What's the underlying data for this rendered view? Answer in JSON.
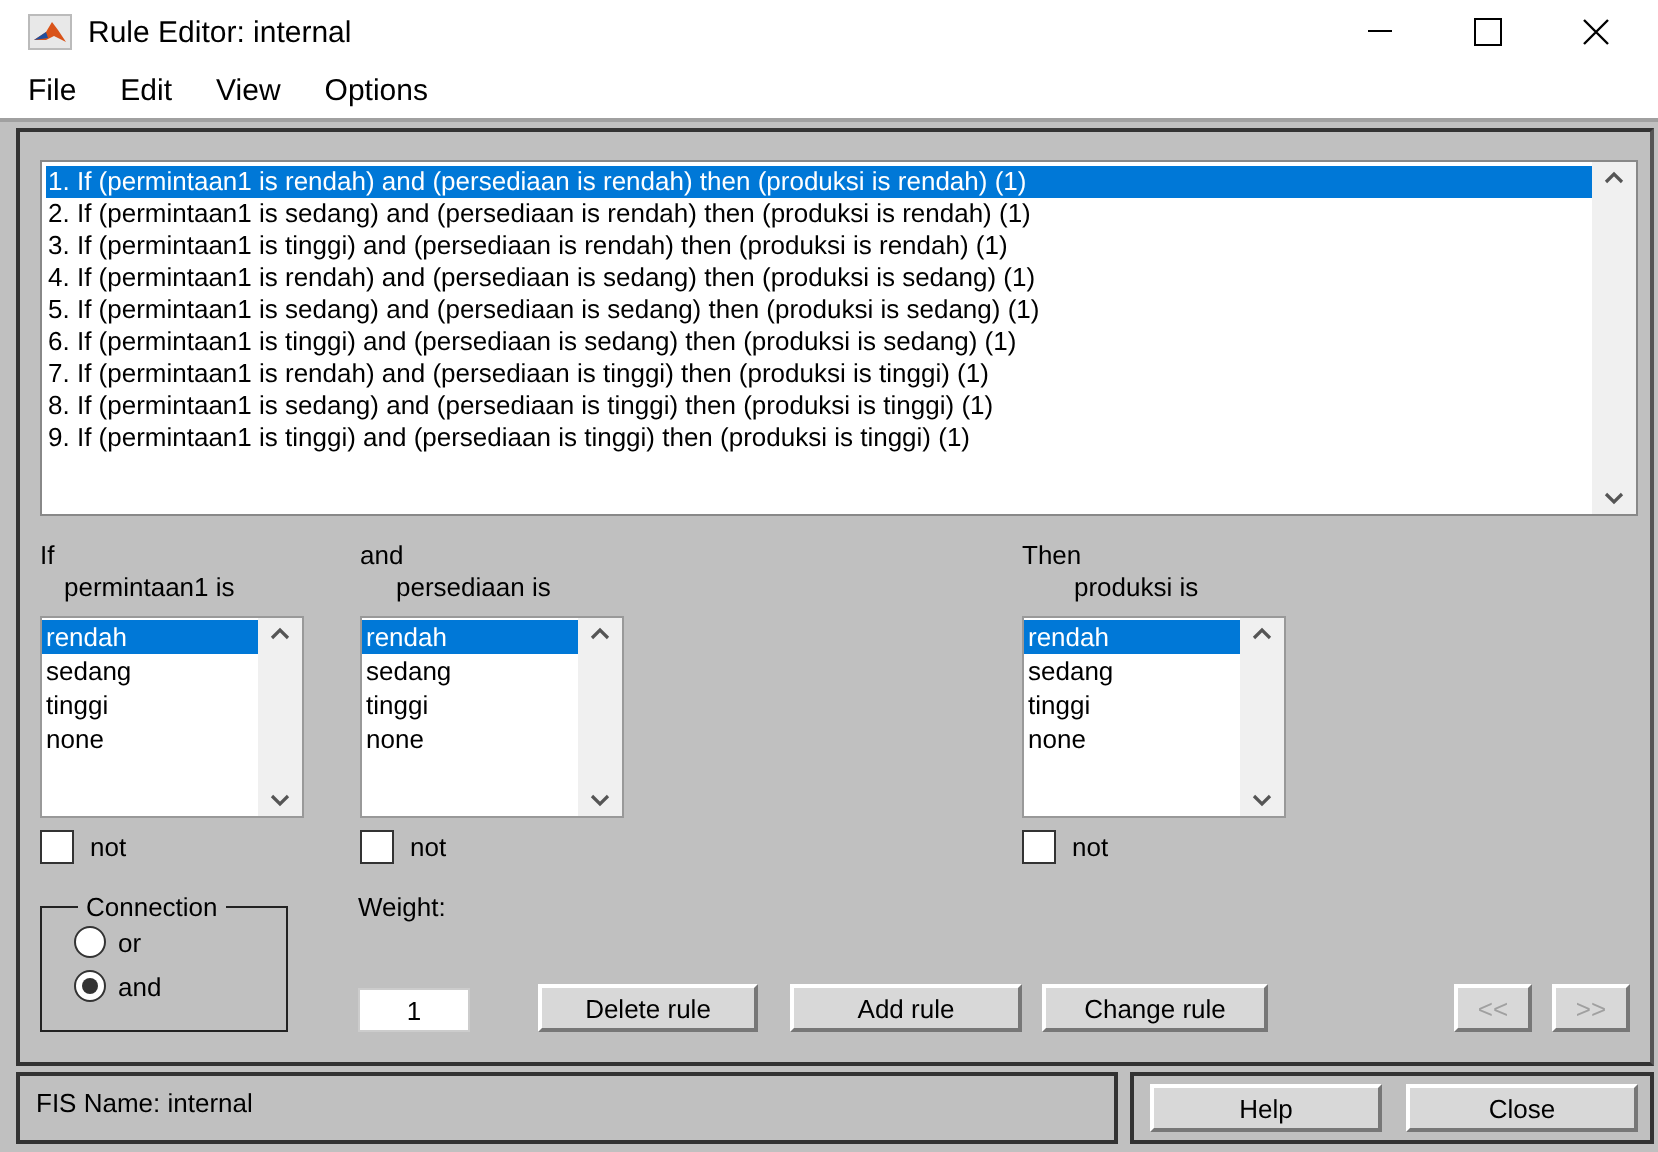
{
  "window": {
    "title": "Rule Editor: internal"
  },
  "menu": [
    "File",
    "Edit",
    "View",
    "Options"
  ],
  "rules": [
    {
      "text": "1. If (permintaan1 is rendah) and (persediaan is rendah) then (produksi is rendah) (1)",
      "selected": true
    },
    {
      "text": "2. If (permintaan1 is sedang) and (persediaan is rendah) then (produksi is rendah) (1)",
      "selected": false
    },
    {
      "text": "3. If (permintaan1 is tinggi) and (persediaan is rendah) then (produksi is rendah) (1)",
      "selected": false
    },
    {
      "text": "4. If (permintaan1 is rendah) and (persediaan is sedang) then (produksi is sedang) (1)",
      "selected": false
    },
    {
      "text": "5. If (permintaan1 is sedang) and (persediaan is sedang) then (produksi is sedang) (1)",
      "selected": false
    },
    {
      "text": "6. If (permintaan1 is tinggi) and (persediaan is sedang) then (produksi is sedang) (1)",
      "selected": false
    },
    {
      "text": "7. If (permintaan1 is rendah) and (persediaan is tinggi) then (produksi is tinggi) (1)",
      "selected": false
    },
    {
      "text": "8. If (permintaan1 is sedang) and (persediaan is tinggi) then (produksi is tinggi) (1)",
      "selected": false
    },
    {
      "text": "9. If (permintaan1 is tinggi) and (persediaan is tinggi) then (produksi is tinggi) (1)",
      "selected": false
    }
  ],
  "variables": [
    {
      "heading": "If",
      "label": "permintaan1 is",
      "options": [
        {
          "text": "rendah",
          "selected": true
        },
        {
          "text": "sedang",
          "selected": false
        },
        {
          "text": "tinggi",
          "selected": false
        },
        {
          "text": "none",
          "selected": false
        }
      ],
      "not": {
        "label": "not",
        "checked": false
      }
    },
    {
      "heading": "and",
      "label": "persediaan is",
      "options": [
        {
          "text": "rendah",
          "selected": true
        },
        {
          "text": "sedang",
          "selected": false
        },
        {
          "text": "tinggi",
          "selected": false
        },
        {
          "text": "none",
          "selected": false
        }
      ],
      "not": {
        "label": "not",
        "checked": false
      }
    },
    {
      "heading": "Then",
      "label": "produksi is",
      "options": [
        {
          "text": "rendah",
          "selected": true
        },
        {
          "text": "sedang",
          "selected": false
        },
        {
          "text": "tinggi",
          "selected": false
        },
        {
          "text": "none",
          "selected": false
        }
      ],
      "not": {
        "label": "not",
        "checked": false
      }
    }
  ],
  "connection": {
    "title": "Connection",
    "options": [
      {
        "label": "or",
        "selected": false
      },
      {
        "label": "and",
        "selected": true
      }
    ]
  },
  "weight": {
    "label": "Weight:",
    "value": "1"
  },
  "rule_buttons": [
    {
      "label": "Delete rule",
      "disabled": false
    },
    {
      "label": "Add rule",
      "disabled": false
    },
    {
      "label": "Change rule",
      "disabled": false
    }
  ],
  "nav_buttons": [
    {
      "label": "<<",
      "disabled": true
    },
    {
      "label": ">>",
      "disabled": true
    }
  ],
  "status": "FIS Name: internal",
  "buttons": [
    "Help",
    "Close"
  ]
}
